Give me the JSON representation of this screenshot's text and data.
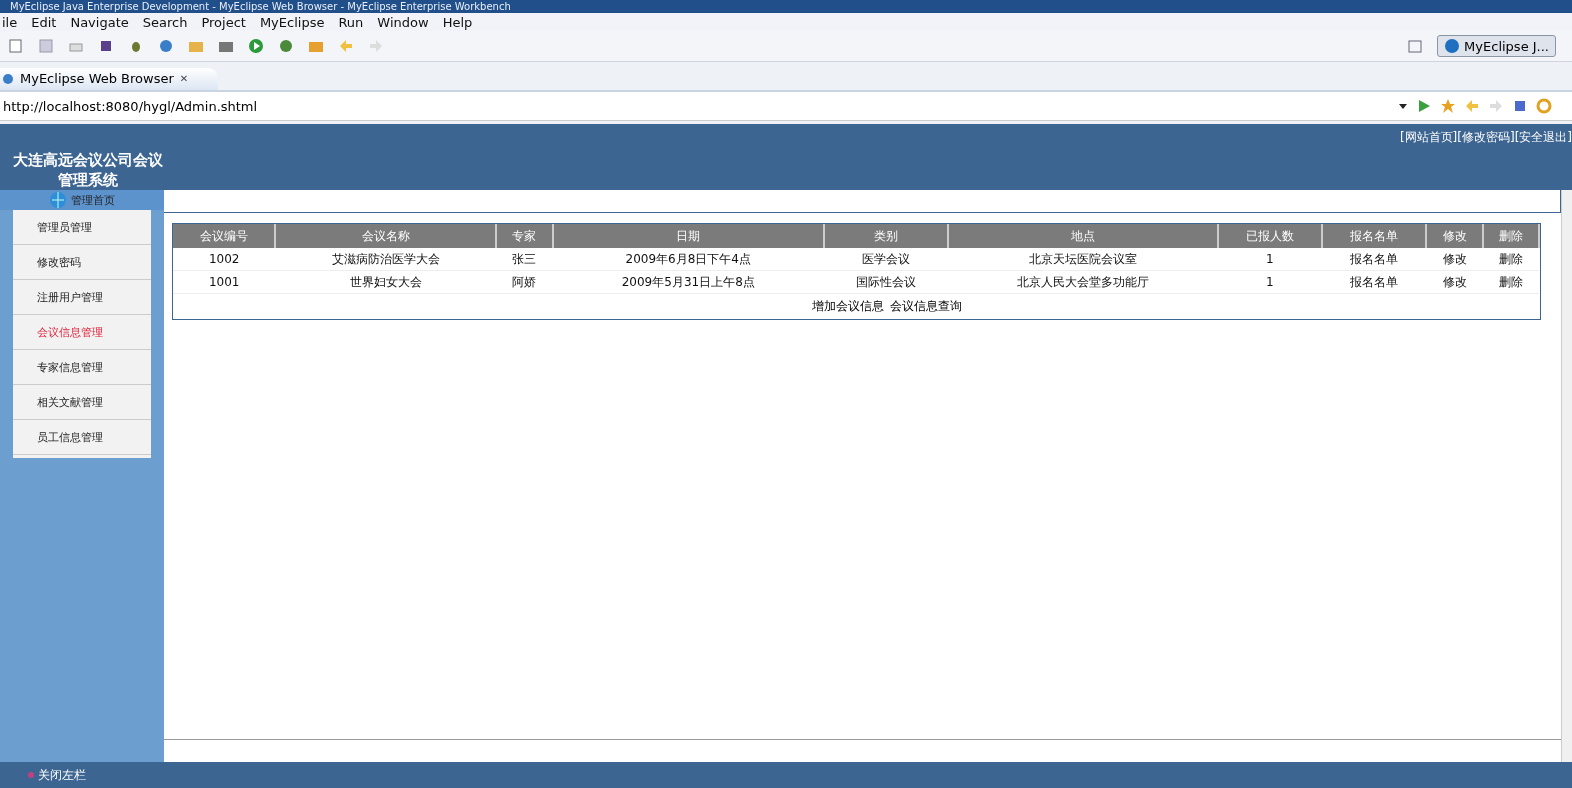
{
  "window": {
    "title": "MyEclipse Java Enterprise Development - MyEclipse Web Browser - MyEclipse Enterprise Workbench"
  },
  "menu": [
    "ile",
    "Edit",
    "Navigate",
    "Search",
    "Project",
    "MyEclipse",
    "Run",
    "Window",
    "Help"
  ],
  "perspective": {
    "label": "MyEclipse J..."
  },
  "editor_tab": {
    "label": "MyEclipse Web Browser",
    "close": "✕"
  },
  "address": {
    "value": "http://localhost:8080/hygl/Admin.shtml"
  },
  "page": {
    "top_links": [
      "[网站首页]",
      "[修改密码]",
      "[安全退出]"
    ],
    "site_title": "大连高远会议公司会议管理系统",
    "home_label": "管理首页",
    "sidebar": [
      {
        "label": "管理员管理",
        "selected": false
      },
      {
        "label": "修改密码",
        "selected": false
      },
      {
        "label": "注册用户管理",
        "selected": false
      },
      {
        "label": "会议信息管理",
        "selected": true
      },
      {
        "label": "专家信息管理",
        "selected": false
      },
      {
        "label": "相关文献管理",
        "selected": false
      },
      {
        "label": "员工信息管理",
        "selected": false
      }
    ],
    "table": {
      "columns": [
        "会议编号",
        "会议名称",
        "专家",
        "日期",
        "类别",
        "地点",
        "已报人数",
        "报名名单",
        "修改",
        "删除"
      ],
      "rows": [
        [
          "1002",
          "艾滋病防治医学大会",
          "张三",
          "2009年6月8日下午4点",
          "医学会议",
          "北京天坛医院会议室",
          "1",
          "报名名单",
          "修改",
          "删除"
        ],
        [
          "1001",
          "世界妇女大会",
          "阿娇",
          "2009年5月31日上午8点",
          "国际性会议",
          "北京人民大会堂多功能厅",
          "1",
          "报名名单",
          "修改",
          "删除"
        ]
      ]
    },
    "table_links": [
      "增加会议信息",
      "会议信息查询"
    ],
    "close_sidebar": "关闭左栏"
  }
}
